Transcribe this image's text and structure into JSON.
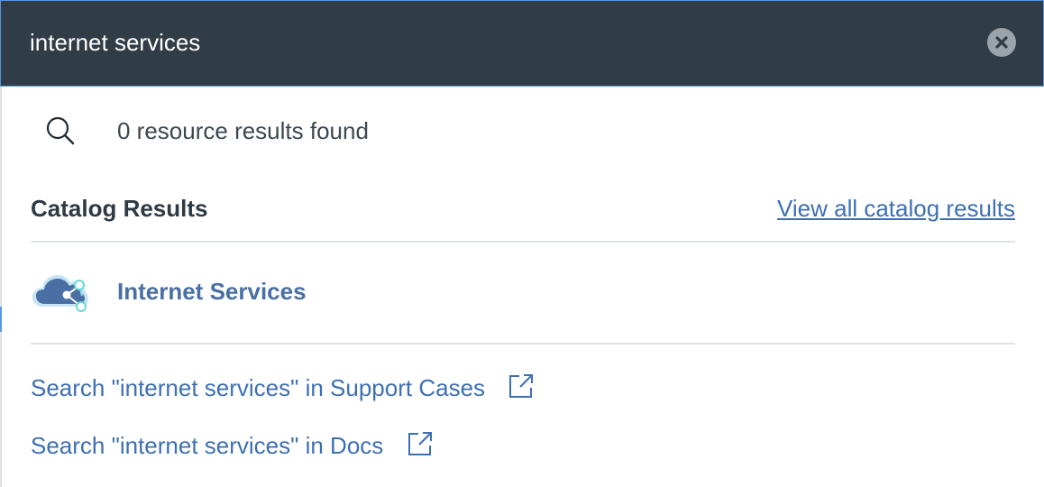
{
  "search": {
    "query": "internet services",
    "clear_icon": "close-circle-icon"
  },
  "resources": {
    "icon": "search-icon",
    "count_text": "0 resource results found"
  },
  "catalog": {
    "heading": "Catalog Results",
    "view_all_label": "View all catalog results",
    "items": [
      {
        "label": "Internet Services",
        "icon": "cloud-share-icon"
      }
    ]
  },
  "search_links": [
    {
      "label": "Search \"internet services\" in Support Cases",
      "icon": "external-link-icon"
    },
    {
      "label": "Search \"internet services\" in Docs",
      "icon": "external-link-icon"
    }
  ],
  "colors": {
    "search_bar_bg": "#303c46",
    "search_bar_border": "#5596e6",
    "link": "#3d70b2",
    "catalog_item_label": "#4a6fa5",
    "heading": "#2e3a44",
    "divider": "#dfe3e6"
  }
}
